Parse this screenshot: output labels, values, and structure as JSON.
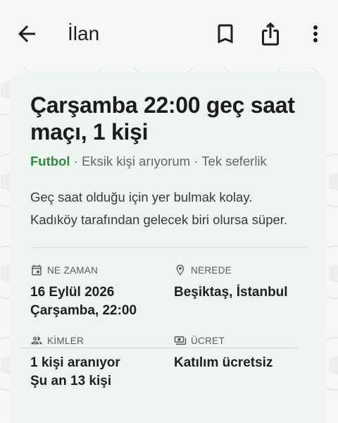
{
  "appbar": {
    "title": "İlan",
    "back_icon": "arrow-back-icon",
    "bookmark_icon": "bookmark-icon",
    "share_icon": "share-icon",
    "more_icon": "more-vertical-icon"
  },
  "listing": {
    "title": "Çarşamba 22:00 geç saat maçı, 1 kişi",
    "sport": "Futbol",
    "sep1": " · ",
    "type": "Eksik kişi arıyorum",
    "sep2": " · ",
    "frequency": "Tek seferlik",
    "description": "Geç saat olduğu için yer bulmak kolay. Kadıköy tarafından gelecek biri olursa süper."
  },
  "details": {
    "when": {
      "label": "NE ZAMAN",
      "line1": "16 Eylül 2026",
      "line2": "Çarşamba, 22:00",
      "icon": "calendar-icon"
    },
    "where": {
      "label": "NEREDE",
      "line1": "Beşiktaş, İstanbul",
      "icon": "location-pin-icon"
    },
    "who": {
      "label": "KİMLER",
      "line1": "1 kişi aranıyor",
      "line2": "Şu an 13 kişi",
      "icon": "people-icon"
    },
    "fee": {
      "label": "ÜCRET",
      "line1": "Katılım ücretsiz",
      "icon": "money-icon"
    }
  },
  "colors": {
    "accent": "#2e8a3e",
    "card_bg": "#eef4ef",
    "page_bg": "#f7f7f5"
  }
}
